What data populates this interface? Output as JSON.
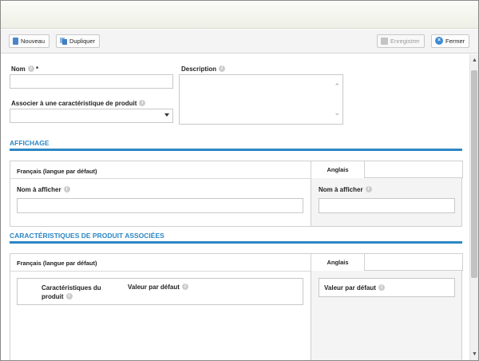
{
  "toolbar": {
    "new_label": "Nouveau",
    "duplicate_label": "Dupliquer",
    "save_label": "Enregistrer",
    "close_label": "Fermer"
  },
  "form": {
    "name_label": "Nom",
    "required_mark": "*",
    "description_label": "Description",
    "associate_label": "Associer à une caractéristique de produit",
    "name_value": "",
    "description_value": "",
    "associate_value": ""
  },
  "display_section": {
    "title": "AFFICHAGE",
    "default_lang_header": "Français (langue par défaut)",
    "tab_label": "Anglais",
    "left_field_label": "Nom à afficher",
    "right_field_label": "Nom à afficher"
  },
  "associated_section": {
    "title": "CARACTÉRISTIQUES DE PRODUIT ASSOCIÉES",
    "default_lang_header": "Français (langue par défaut)",
    "tab_label": "Anglais",
    "col_characteristic": "Caractéristiques du produit",
    "col_default_value": "Valeur par défaut",
    "right_col_default_value": "Valeur par défaut"
  },
  "icons": {
    "new": "document-icon",
    "duplicate": "duplicate-icon",
    "save": "save-icon",
    "close": "close-icon",
    "info": "info-icon",
    "dropdown": "chevron-down-icon"
  }
}
